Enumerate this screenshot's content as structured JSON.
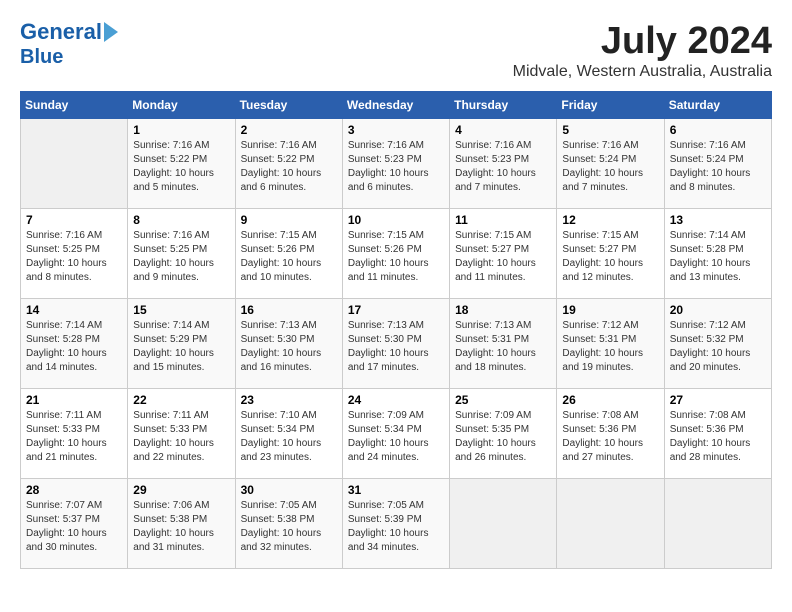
{
  "logo": {
    "line1": "General",
    "line2": "Blue"
  },
  "title": "July 2024",
  "subtitle": "Midvale, Western Australia, Australia",
  "days_header": [
    "Sunday",
    "Monday",
    "Tuesday",
    "Wednesday",
    "Thursday",
    "Friday",
    "Saturday"
  ],
  "weeks": [
    [
      {
        "day": "",
        "info": ""
      },
      {
        "day": "1",
        "info": "Sunrise: 7:16 AM\nSunset: 5:22 PM\nDaylight: 10 hours\nand 5 minutes."
      },
      {
        "day": "2",
        "info": "Sunrise: 7:16 AM\nSunset: 5:22 PM\nDaylight: 10 hours\nand 6 minutes."
      },
      {
        "day": "3",
        "info": "Sunrise: 7:16 AM\nSunset: 5:23 PM\nDaylight: 10 hours\nand 6 minutes."
      },
      {
        "day": "4",
        "info": "Sunrise: 7:16 AM\nSunset: 5:23 PM\nDaylight: 10 hours\nand 7 minutes."
      },
      {
        "day": "5",
        "info": "Sunrise: 7:16 AM\nSunset: 5:24 PM\nDaylight: 10 hours\nand 7 minutes."
      },
      {
        "day": "6",
        "info": "Sunrise: 7:16 AM\nSunset: 5:24 PM\nDaylight: 10 hours\nand 8 minutes."
      }
    ],
    [
      {
        "day": "7",
        "info": "Sunrise: 7:16 AM\nSunset: 5:25 PM\nDaylight: 10 hours\nand 8 minutes."
      },
      {
        "day": "8",
        "info": "Sunrise: 7:16 AM\nSunset: 5:25 PM\nDaylight: 10 hours\nand 9 minutes."
      },
      {
        "day": "9",
        "info": "Sunrise: 7:15 AM\nSunset: 5:26 PM\nDaylight: 10 hours\nand 10 minutes."
      },
      {
        "day": "10",
        "info": "Sunrise: 7:15 AM\nSunset: 5:26 PM\nDaylight: 10 hours\nand 11 minutes."
      },
      {
        "day": "11",
        "info": "Sunrise: 7:15 AM\nSunset: 5:27 PM\nDaylight: 10 hours\nand 11 minutes."
      },
      {
        "day": "12",
        "info": "Sunrise: 7:15 AM\nSunset: 5:27 PM\nDaylight: 10 hours\nand 12 minutes."
      },
      {
        "day": "13",
        "info": "Sunrise: 7:14 AM\nSunset: 5:28 PM\nDaylight: 10 hours\nand 13 minutes."
      }
    ],
    [
      {
        "day": "14",
        "info": "Sunrise: 7:14 AM\nSunset: 5:28 PM\nDaylight: 10 hours\nand 14 minutes."
      },
      {
        "day": "15",
        "info": "Sunrise: 7:14 AM\nSunset: 5:29 PM\nDaylight: 10 hours\nand 15 minutes."
      },
      {
        "day": "16",
        "info": "Sunrise: 7:13 AM\nSunset: 5:30 PM\nDaylight: 10 hours\nand 16 minutes."
      },
      {
        "day": "17",
        "info": "Sunrise: 7:13 AM\nSunset: 5:30 PM\nDaylight: 10 hours\nand 17 minutes."
      },
      {
        "day": "18",
        "info": "Sunrise: 7:13 AM\nSunset: 5:31 PM\nDaylight: 10 hours\nand 18 minutes."
      },
      {
        "day": "19",
        "info": "Sunrise: 7:12 AM\nSunset: 5:31 PM\nDaylight: 10 hours\nand 19 minutes."
      },
      {
        "day": "20",
        "info": "Sunrise: 7:12 AM\nSunset: 5:32 PM\nDaylight: 10 hours\nand 20 minutes."
      }
    ],
    [
      {
        "day": "21",
        "info": "Sunrise: 7:11 AM\nSunset: 5:33 PM\nDaylight: 10 hours\nand 21 minutes."
      },
      {
        "day": "22",
        "info": "Sunrise: 7:11 AM\nSunset: 5:33 PM\nDaylight: 10 hours\nand 22 minutes."
      },
      {
        "day": "23",
        "info": "Sunrise: 7:10 AM\nSunset: 5:34 PM\nDaylight: 10 hours\nand 23 minutes."
      },
      {
        "day": "24",
        "info": "Sunrise: 7:09 AM\nSunset: 5:34 PM\nDaylight: 10 hours\nand 24 minutes."
      },
      {
        "day": "25",
        "info": "Sunrise: 7:09 AM\nSunset: 5:35 PM\nDaylight: 10 hours\nand 26 minutes."
      },
      {
        "day": "26",
        "info": "Sunrise: 7:08 AM\nSunset: 5:36 PM\nDaylight: 10 hours\nand 27 minutes."
      },
      {
        "day": "27",
        "info": "Sunrise: 7:08 AM\nSunset: 5:36 PM\nDaylight: 10 hours\nand 28 minutes."
      }
    ],
    [
      {
        "day": "28",
        "info": "Sunrise: 7:07 AM\nSunset: 5:37 PM\nDaylight: 10 hours\nand 30 minutes."
      },
      {
        "day": "29",
        "info": "Sunrise: 7:06 AM\nSunset: 5:38 PM\nDaylight: 10 hours\nand 31 minutes."
      },
      {
        "day": "30",
        "info": "Sunrise: 7:05 AM\nSunset: 5:38 PM\nDaylight: 10 hours\nand 32 minutes."
      },
      {
        "day": "31",
        "info": "Sunrise: 7:05 AM\nSunset: 5:39 PM\nDaylight: 10 hours\nand 34 minutes."
      },
      {
        "day": "",
        "info": ""
      },
      {
        "day": "",
        "info": ""
      },
      {
        "day": "",
        "info": ""
      }
    ]
  ]
}
